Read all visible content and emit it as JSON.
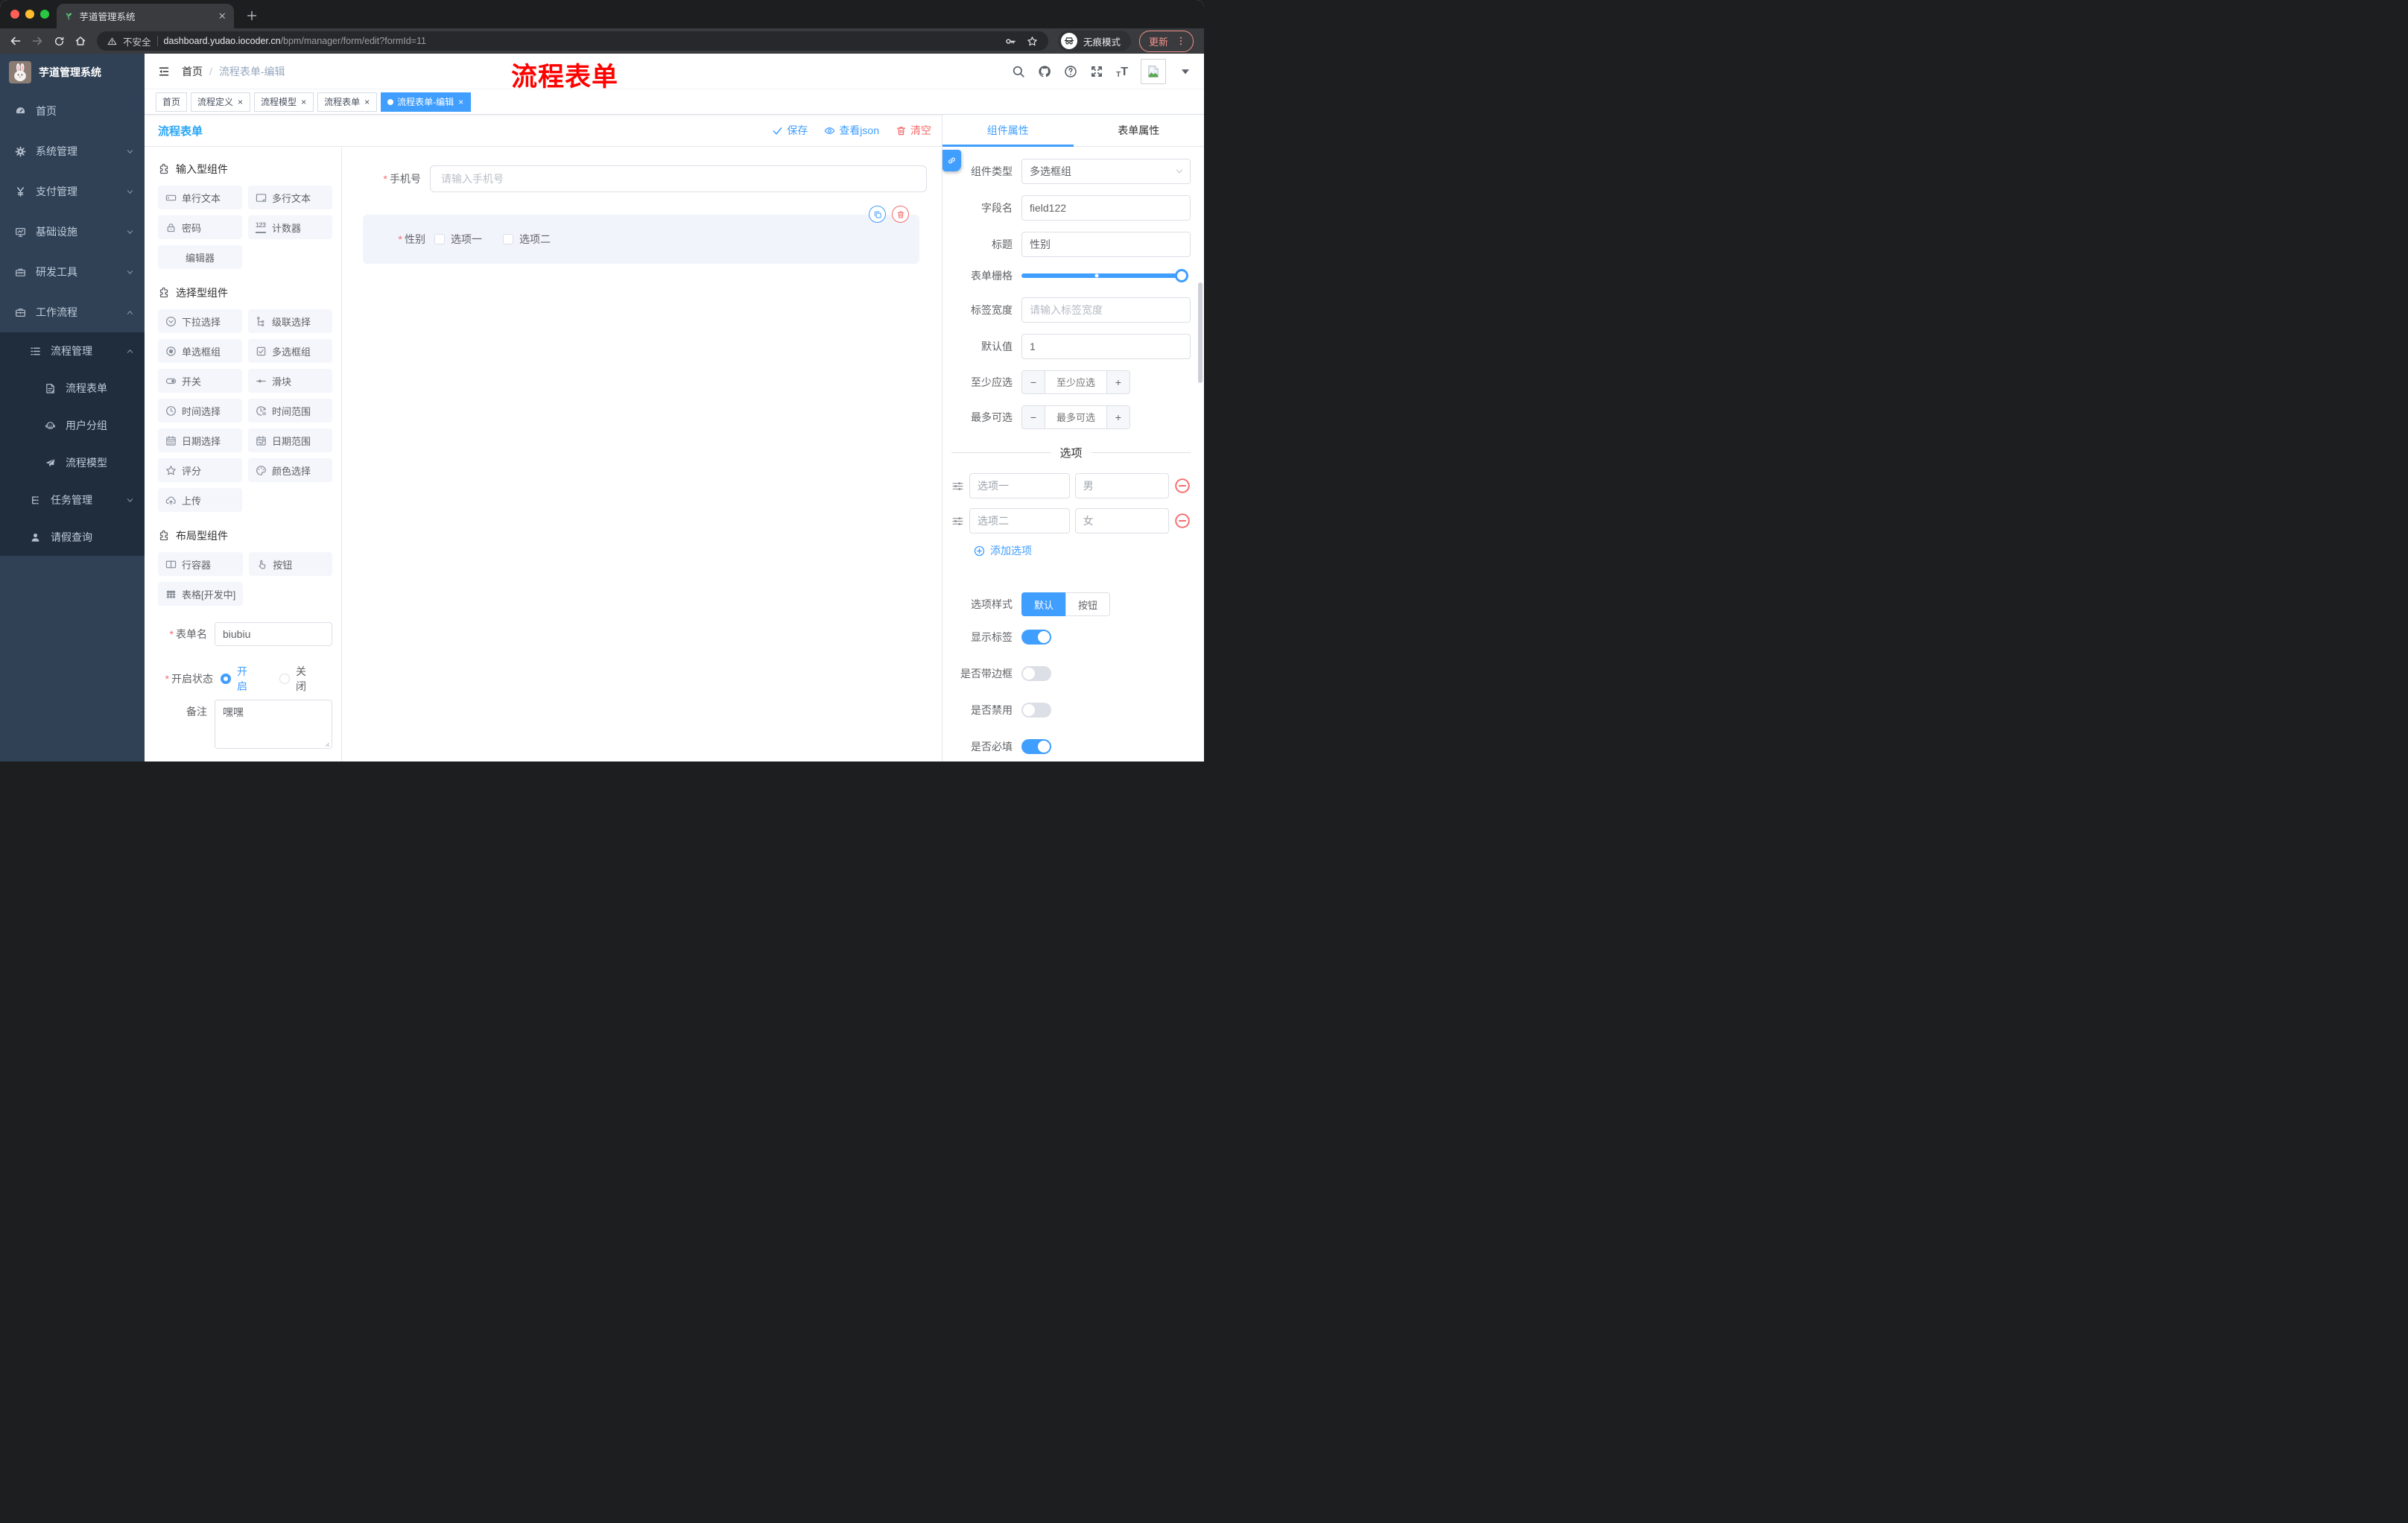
{
  "colors": {
    "primary": "#409EFF",
    "danger": "#F56C6C",
    "title_accent": "#2BA6F5",
    "annotation_red": "#FD0200",
    "sidebar_bg": "#304156",
    "submenu_bg": "#1F2D3D"
  },
  "browser": {
    "tab_title": "芋道管理系统",
    "security_label": "不安全",
    "url_host": "dashboard.yudao.iocoder.cn",
    "url_path": "/bpm/manager/form/edit?formId=11",
    "incognito_label": "无痕模式",
    "update_label": "更新"
  },
  "sidebar": {
    "logo_title": "芋道管理系统",
    "menu": [
      {
        "label": "首页",
        "icon": "dashboard-icon",
        "level": 0,
        "chevron": "",
        "dark": false
      },
      {
        "label": "系统管理",
        "icon": "gear-icon",
        "level": 0,
        "chevron": "down",
        "dark": false
      },
      {
        "label": "支付管理",
        "icon": "yen-icon",
        "level": 0,
        "chevron": "down",
        "dark": false
      },
      {
        "label": "基础设施",
        "icon": "monitor-icon",
        "level": 0,
        "chevron": "down",
        "dark": false
      },
      {
        "label": "研发工具",
        "icon": "toolbox-icon",
        "level": 0,
        "chevron": "down",
        "dark": false
      },
      {
        "label": "工作流程",
        "icon": "briefcase-icon",
        "level": 0,
        "chevron": "up",
        "dark": false
      },
      {
        "label": "流程管理",
        "icon": "workflow-list-icon",
        "level": 1,
        "chevron": "up",
        "dark": true
      },
      {
        "label": "流程表单",
        "icon": "form-doc-icon",
        "level": 2,
        "chevron": "",
        "dark": true
      },
      {
        "label": "用户分组",
        "icon": "user-group-icon",
        "level": 2,
        "chevron": "",
        "dark": true
      },
      {
        "label": "流程模型",
        "icon": "paper-plane-icon",
        "level": 2,
        "chevron": "",
        "dark": true
      },
      {
        "label": "任务管理",
        "icon": "task-tree-icon",
        "level": 1,
        "chevron": "down",
        "dark": true
      },
      {
        "label": "请假查询",
        "icon": "person-icon",
        "level": 1,
        "chevron": "",
        "dark": true
      }
    ]
  },
  "app_header": {
    "breadcrumb": [
      "首页",
      "流程表单-编辑"
    ],
    "breadcrumb_separator": "/",
    "annotation": "流程表单"
  },
  "tags_view": [
    {
      "label": "首页",
      "closable": false,
      "active": false
    },
    {
      "label": "流程定义",
      "closable": true,
      "active": false
    },
    {
      "label": "流程模型",
      "closable": true,
      "active": false
    },
    {
      "label": "流程表单",
      "closable": true,
      "active": false
    },
    {
      "label": "流程表单-编辑",
      "closable": true,
      "active": true
    }
  ],
  "designer": {
    "title": "流程表单",
    "save": "保存",
    "view_json": "查看json",
    "clear": "清空"
  },
  "component_groups": [
    {
      "title": "输入型组件",
      "items": [
        {
          "label": "单行文本",
          "icon": "input-icon"
        },
        {
          "label": "多行文本",
          "icon": "textarea-icon"
        },
        {
          "label": "密码",
          "icon": "lock-icon"
        },
        {
          "label": "计数器",
          "icon": "counter-icon"
        },
        {
          "label": "编辑器",
          "icon": ""
        }
      ]
    },
    {
      "title": "选择型组件",
      "items": [
        {
          "label": "下拉选择",
          "icon": "select-icon"
        },
        {
          "label": "级联选择",
          "icon": "cascade-icon"
        },
        {
          "label": "单选框组",
          "icon": "radio-icon"
        },
        {
          "label": "多选框组",
          "icon": "checkbox-icon"
        },
        {
          "label": "开关",
          "icon": "switch-icon"
        },
        {
          "label": "滑块",
          "icon": "slider-icon"
        },
        {
          "label": "时间选择",
          "icon": "time-icon"
        },
        {
          "label": "时间范围",
          "icon": "time-range-icon"
        },
        {
          "label": "日期选择",
          "icon": "date-icon"
        },
        {
          "label": "日期范围",
          "icon": "date-range-icon"
        },
        {
          "label": "评分",
          "icon": "rate-star-icon"
        },
        {
          "label": "颜色选择",
          "icon": "color-icon"
        },
        {
          "label": "上传",
          "icon": "upload-icon"
        }
      ]
    },
    {
      "title": "布局型组件",
      "items": [
        {
          "label": "行容器",
          "icon": "row-icon"
        },
        {
          "label": "按钮",
          "icon": "button-icon"
        },
        {
          "label": "表格[开发中]",
          "icon": "table-icon"
        }
      ]
    }
  ],
  "panel_form": {
    "name": {
      "label": "表单名",
      "required": true,
      "value": "biubiu"
    },
    "status": {
      "label": "开启状态",
      "required": true,
      "options": [
        {
          "label": "开启",
          "selected": true
        },
        {
          "label": "关闭",
          "selected": false
        }
      ]
    },
    "remark": {
      "label": "备注",
      "value": "嘿嘿"
    }
  },
  "canvas": {
    "phone": {
      "label": "手机号",
      "required": true,
      "placeholder": "请输入手机号"
    },
    "gender": {
      "label": "性别",
      "required": true,
      "options": [
        "选项一",
        "选项二"
      ]
    }
  },
  "props": {
    "tabs": [
      {
        "label": "组件属性",
        "active": true
      },
      {
        "label": "表单属性",
        "active": false
      }
    ],
    "rows": {
      "component_type": {
        "label": "组件类型",
        "value": "多选框组"
      },
      "field_name": {
        "label": "字段名",
        "value": "field122"
      },
      "title": {
        "label": "标题",
        "value": "性别"
      },
      "grid": {
        "label": "表单栅格",
        "value_percent": 100,
        "mark_percent": 47
      },
      "label_width": {
        "label": "标签宽度",
        "placeholder": "请输入标签宽度"
      },
      "default_value": {
        "label": "默认值",
        "value": "1"
      },
      "min_select": {
        "label": "至少应选",
        "placeholder": "至少应选"
      },
      "max_select": {
        "label": "最多可选",
        "placeholder": "最多可选"
      }
    },
    "options": {
      "divider_label": "选项",
      "items": [
        {
          "label": "选项一",
          "value": "男"
        },
        {
          "label": "选项二",
          "value": "女"
        }
      ],
      "add_label": "添加选项"
    },
    "style": {
      "label": "选项样式",
      "choices": [
        {
          "label": "默认",
          "active": true
        },
        {
          "label": "按钮",
          "active": false
        }
      ]
    },
    "switches": [
      {
        "label": "显示标签",
        "on": true
      },
      {
        "label": "是否带边框",
        "on": false
      },
      {
        "label": "是否禁用",
        "on": false
      },
      {
        "label": "是否必填",
        "on": true
      }
    ]
  }
}
